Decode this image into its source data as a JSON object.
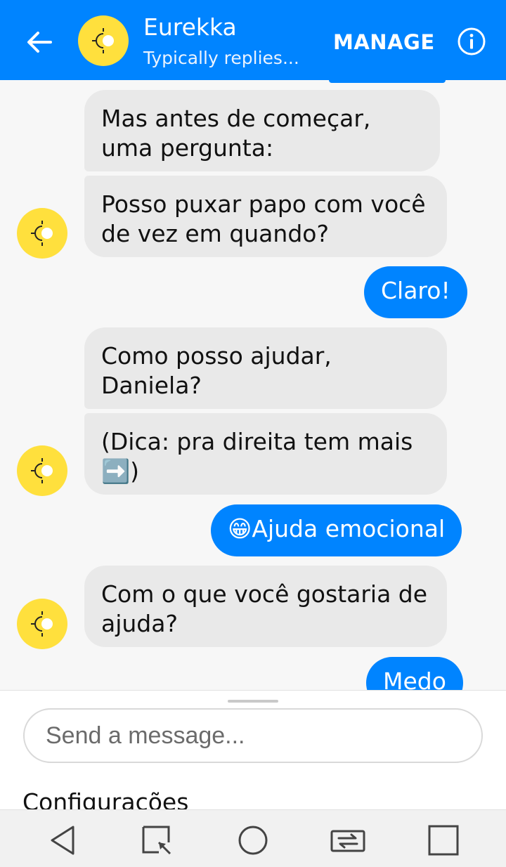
{
  "header": {
    "title": "Eurekka",
    "subtitle": "Typically replies...",
    "manage_label": "MANAGE",
    "icons": {
      "back": "arrow-left-icon",
      "avatar": "eurekka-sun-logo",
      "info": "info-icon"
    },
    "accent_color": "#0084ff"
  },
  "messages": [
    {
      "from": "bot",
      "text": "Mas antes de começar, uma pergunta:"
    },
    {
      "from": "bot",
      "text": "Posso puxar papo com você de vez em quando?"
    },
    {
      "from": "user",
      "text": "Claro!"
    },
    {
      "from": "bot",
      "text": "Como posso ajudar, Daniela?"
    },
    {
      "from": "bot",
      "text": "(Dica: pra direita tem mais ➡️)"
    },
    {
      "from": "user",
      "text": "😁Ajuda emocional"
    },
    {
      "from": "bot",
      "text": "Com o que você gostaria de ajuda?"
    },
    {
      "from": "user",
      "text": "Medo"
    }
  ],
  "composer": {
    "placeholder": "Send a message...",
    "menu_label": "Configurações"
  },
  "navbar": {
    "icons": [
      "back-triangle-icon",
      "screenshot-edit-icon",
      "home-circle-icon",
      "switch-sim-icon",
      "recent-apps-square-icon"
    ]
  }
}
